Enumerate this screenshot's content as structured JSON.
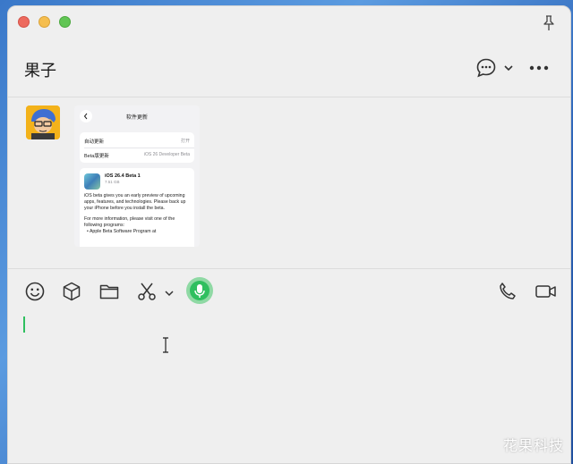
{
  "chat": {
    "title": "果子"
  },
  "screenshot_message": {
    "page_title": "软件更新",
    "rows": [
      {
        "label": "自动更新",
        "value": "打开"
      },
      {
        "label": "Beta版更新",
        "value": "iOS 26 Developer Beta"
      }
    ],
    "update_name": "iOS 26.4 Beta 1",
    "update_size": "7.51 GB",
    "description_1": "iOS beta gives you an early preview of upcoming apps, features, and technologies. Please back up your iPhone before you install the beta.",
    "description_2": "For more information, please visit one of the following programs:",
    "bullet": "• Apple Beta Software Program at"
  },
  "toolbar": {
    "icons": [
      "emoji-icon",
      "cube-icon",
      "folder-icon",
      "scissors-icon",
      "chevron-down-icon",
      "microphone-icon",
      "phone-icon",
      "video-icon"
    ]
  },
  "watermark": "花果科技",
  "colors": {
    "accent": "#2fbf5f",
    "window_bg": "#efefef"
  }
}
